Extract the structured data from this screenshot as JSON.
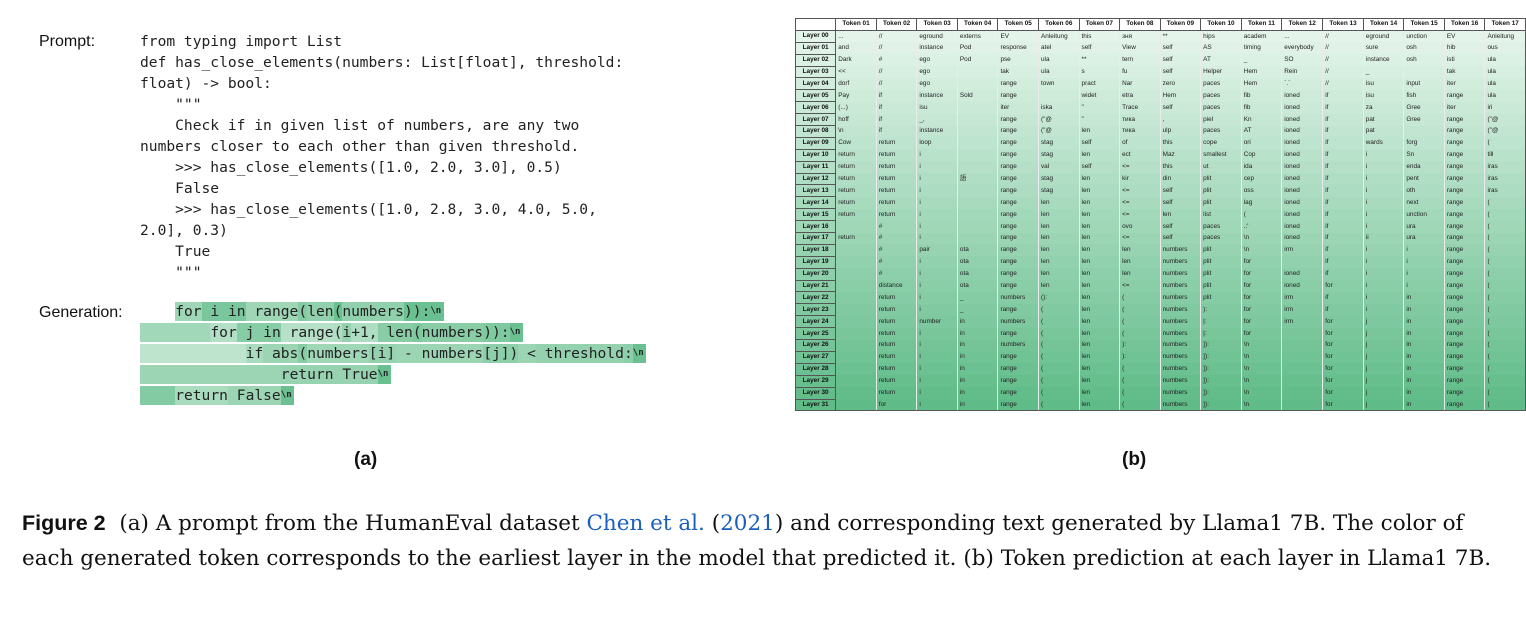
{
  "panel_a": {
    "prompt_label": "Prompt:",
    "generation_label": "Generation:",
    "prompt_lines": [
      "from typing import List",
      "def has_close_elements(numbers: List[float], threshold:",
      "float) -> bool:",
      "    \"\"\"",
      "    Check if in given list of numbers, are any two",
      "numbers closer to each other than given threshold.",
      "    >>> has_close_elements([1.0, 2.0, 3.0], 0.5)",
      "    False",
      "    >>> has_close_elements([1.0, 2.8, 3.0, 4.0, 5.0,",
      "2.0], 0.3)",
      "    True",
      "    \"\"\""
    ],
    "generation_lines": [
      [
        {
          "t": "    ",
          "s": 0
        },
        {
          "t": "for",
          "s": 0.53
        },
        {
          "t": " i",
          "s": 0.78
        },
        {
          "t": " in",
          "s": 0.78
        },
        {
          "t": " range",
          "s": 0.53
        },
        {
          "t": "(",
          "s": 0.72
        },
        {
          "t": "len",
          "s": 0.63
        },
        {
          "t": "(",
          "s": 0.9
        },
        {
          "t": "numbers",
          "s": 0.63
        },
        {
          "t": ")):",
          "s": 0.9
        },
        {
          "t": "\\n",
          "s": 0.9,
          "nl": true
        }
      ],
      [
        {
          "t": "        ",
          "s": 0.5
        },
        {
          "t": "for",
          "s": 0.38
        },
        {
          "t": " j",
          "s": 0.7
        },
        {
          "t": " in",
          "s": 0.7
        },
        {
          "t": " range",
          "s": 0.36
        },
        {
          "t": "(",
          "s": 0.4
        },
        {
          "t": "i",
          "s": 0.6
        },
        {
          "t": "+1,",
          "s": 0.42
        },
        {
          "t": " len",
          "s": 0.68
        },
        {
          "t": "(",
          "s": 0.75
        },
        {
          "t": "numbers",
          "s": 0.68
        },
        {
          "t": ")):",
          "s": 0.75
        },
        {
          "t": "\\n",
          "s": 0.9,
          "nl": true
        }
      ],
      [
        {
          "t": "            ",
          "s": 0.3
        },
        {
          "t": "if",
          "s": 0.45
        },
        {
          "t": " abs",
          "s": 0.55
        },
        {
          "t": "(",
          "s": 0.7
        },
        {
          "t": "numbers",
          "s": 0.52
        },
        {
          "t": "[i]",
          "s": 0.6
        },
        {
          "t": " -",
          "s": 0.55
        },
        {
          "t": " numbers",
          "s": 0.55
        },
        {
          "t": "[j])",
          "s": 0.65
        },
        {
          "t": " <",
          "s": 0.55
        },
        {
          "t": " threshold",
          "s": 0.6
        },
        {
          "t": ":",
          "s": 0.65
        },
        {
          "t": "\\n",
          "s": 0.9,
          "nl": true
        }
      ],
      [
        {
          "t": "                ",
          "s": 0.55
        },
        {
          "t": "return",
          "s": 0.58
        },
        {
          "t": " True",
          "s": 0.58
        },
        {
          "t": "\\n",
          "s": 0.9,
          "nl": true
        }
      ],
      [
        {
          "t": "    ",
          "s": 0.72
        },
        {
          "t": "return",
          "s": 0.45
        },
        {
          "t": " False",
          "s": 0.55
        },
        {
          "t": "\\n",
          "s": 0.9,
          "nl": true
        }
      ]
    ]
  },
  "panel_labels": {
    "a": "(a)",
    "b": "(b)"
  },
  "layer_table": {
    "headers": [
      "",
      "Token 01",
      "Token 02",
      "Token 03",
      "Token 04",
      "Token 05",
      "Token 06",
      "Token 07",
      "Token 08",
      "Token 09",
      "Token 10",
      "Token 11",
      "Token 12",
      "Token 13",
      "Token 14",
      "Token 15",
      "Token 16",
      "Token 17"
    ],
    "rows": [
      {
        "layer": "Layer 00",
        "cells": [
          "...",
          "//",
          "eground",
          "externs",
          "EV",
          "Anleitung",
          "this",
          "зня",
          "**",
          "hips",
          "academ",
          "...",
          "//",
          "eground",
          "unction",
          "EV",
          "Anleitung"
        ]
      },
      {
        "layer": "Layer 01",
        "cells": [
          "and",
          "//",
          "instance",
          "Pod",
          "response",
          "atel",
          "self",
          "View",
          "self",
          "AS",
          "timing",
          "everybody",
          "//",
          "sure",
          "osh",
          "hib",
          "ous"
        ]
      },
      {
        "layer": "Layer 02",
        "cells": [
          "Dark",
          "#",
          "ego",
          "Pod",
          "pse",
          "ula",
          "**",
          "tern",
          "self",
          "AT",
          "_",
          "SO",
          "//",
          "instance",
          "osh",
          "isti",
          "ula"
        ]
      },
      {
        "layer": "Layer 03",
        "cells": [
          "<<",
          "//",
          "ego",
          "",
          "tak",
          "ula",
          "s",
          "fu",
          "self",
          "Helper",
          "Hem",
          "Rein",
          "//",
          "_",
          "",
          "tak",
          "ula"
        ]
      },
      {
        "layer": "Layer 04",
        "cells": [
          "dorf",
          "//",
          "ego",
          "",
          "range",
          "town",
          "pract",
          "Nar",
          "zero",
          "paces",
          "Hem",
          "`.`",
          "//",
          "isu",
          "input",
          "iter",
          "ula"
        ]
      },
      {
        "layer": "Layer 05",
        "cells": [
          "Pay",
          "if",
          "instance",
          "Sold",
          "range",
          "",
          "widet",
          "etra",
          "Hem",
          "paces",
          "fib",
          "ioned",
          "if",
          "isu",
          "fish",
          "range",
          "ula"
        ]
      },
      {
        "layer": "Layer 06",
        "cells": [
          "(...)",
          "if",
          "isu",
          "",
          "iter",
          "iska",
          "\"",
          "Trace",
          "self",
          "paces",
          "fib",
          "ioned",
          "if",
          "za",
          "Gree",
          "iter",
          "iri"
        ]
      },
      {
        "layer": "Layer 07",
        "cells": [
          "hoff",
          "if",
          "_,",
          "",
          "range",
          "(\"@",
          "\"",
          "тика",
          ",",
          "piel",
          "Kn",
          "ioned",
          "if",
          "pat",
          "Gree",
          "range",
          "(\"@"
        ]
      },
      {
        "layer": "Layer 08",
        "cells": [
          "\\n",
          "if",
          "instance",
          "",
          "range",
          "(\"@",
          "len",
          "тика",
          "ulp",
          "paces",
          "AT",
          "ioned",
          "if",
          "pat",
          "",
          "range",
          "(\"@"
        ]
      },
      {
        "layer": "Layer 09",
        "cells": [
          "Cow",
          "return",
          "loop",
          "",
          "range",
          "stag",
          "self",
          "of",
          "this",
          "cope",
          "ori",
          "ioned",
          "if",
          "wards",
          "forg",
          "range",
          "("
        ]
      },
      {
        "layer": "Layer 10",
        "cells": [
          "return",
          "return",
          "i",
          "",
          "range",
          "stag",
          "len",
          "ect",
          "Maz",
          "smallest",
          "Cop",
          "ioned",
          "if",
          "i",
          "Sn",
          "range",
          "till"
        ]
      },
      {
        "layer": "Layer 11",
        "cells": [
          "return",
          "return",
          "i",
          "",
          "range",
          "val",
          "self",
          "<=",
          "this",
          "ut",
          "ida",
          "ioned",
          "if",
          "i",
          "enda",
          "range",
          "iras"
        ]
      },
      {
        "layer": "Layer 12",
        "cells": [
          "return",
          "return",
          "i",
          "語",
          "range",
          "stag",
          "len",
          "kir",
          "din",
          "plit",
          "cep",
          "ioned",
          "if",
          "i",
          "pent",
          "range",
          "iras"
        ]
      },
      {
        "layer": "Layer 13",
        "cells": [
          "return",
          "return",
          "i",
          "",
          "range",
          "stag",
          "len",
          "<=",
          "self",
          "plit",
          "oss",
          "ioned",
          "if",
          "i",
          "oth",
          "range",
          "iras"
        ]
      },
      {
        "layer": "Layer 14",
        "cells": [
          "return",
          "return",
          "i",
          "",
          "range",
          "len",
          "len",
          "<=",
          "self",
          "plit",
          "lag",
          "ioned",
          "if",
          "i",
          "next",
          "range",
          "("
        ]
      },
      {
        "layer": "Layer 15",
        "cells": [
          "return",
          "return",
          "i",
          "",
          "range",
          "len",
          "len",
          "<=",
          "len",
          "list",
          "(",
          "ioned",
          "if",
          "i",
          "unction",
          "range",
          "("
        ]
      },
      {
        "layer": "Layer 16",
        "cells": [
          "",
          "#",
          "i",
          "",
          "range",
          "len",
          "len",
          "ovo",
          "self",
          "paces",
          ".:'",
          "ioned",
          "if",
          "i",
          "ura",
          "range",
          "("
        ]
      },
      {
        "layer": "Layer 17",
        "cells": [
          "return",
          "#",
          "i",
          "",
          "range",
          "len",
          "len",
          "<=",
          "self",
          "paces",
          "\\n",
          "ioned",
          "if",
          "ii",
          "ura",
          "range",
          "("
        ]
      },
      {
        "layer": "Layer 18",
        "cells": [
          "",
          "#",
          "pair",
          "ota",
          "range",
          "len",
          "len",
          "len",
          "numbers",
          "plit",
          "\\n",
          "irm",
          "if",
          "i",
          "i",
          "range",
          "("
        ]
      },
      {
        "layer": "Layer 19",
        "cells": [
          "",
          "#",
          "i",
          "ota",
          "range",
          "len",
          "len",
          "len",
          "numbers",
          "plit",
          "for",
          "",
          "if",
          "i",
          "i",
          "range",
          "("
        ]
      },
      {
        "layer": "Layer 20",
        "cells": [
          "",
          "#",
          "i",
          "ota",
          "range",
          "len",
          "len",
          "len",
          "numbers",
          "plit",
          "for",
          "ioned",
          "if",
          "i",
          "i",
          "range",
          "("
        ]
      },
      {
        "layer": "Layer 21",
        "cells": [
          "",
          "distance",
          "i",
          "ota",
          "range",
          "len",
          "len",
          "<=",
          "numbers",
          "plit",
          "for",
          "ioned",
          "for",
          "i",
          "i",
          "range",
          "("
        ]
      },
      {
        "layer": "Layer 22",
        "cells": [
          "",
          "return",
          "i",
          "_",
          "numbers",
          "():",
          "len",
          "(",
          "numbers",
          "plit",
          "for",
          "irm",
          "if",
          "i",
          "in",
          "range",
          "("
        ]
      },
      {
        "layer": "Layer 23",
        "cells": [
          "",
          "return",
          "i",
          "_",
          "range",
          "(",
          "len",
          "(",
          "numbers",
          "):",
          "for",
          "irm",
          "if",
          "i",
          "in",
          "range",
          "("
        ]
      },
      {
        "layer": "Layer 24",
        "cells": [
          "",
          "return",
          "number",
          "in",
          "numbers",
          "(",
          "len",
          "(",
          "numbers",
          "|:",
          "for",
          "irm",
          "for",
          "j",
          "in",
          "range",
          "("
        ]
      },
      {
        "layer": "Layer 25",
        "cells": [
          "",
          "return",
          "i",
          "in",
          "range",
          "(",
          "len",
          "(",
          "numbers",
          "|:",
          "for",
          "",
          "for",
          "j",
          "in",
          "range",
          "("
        ]
      },
      {
        "layer": "Layer 26",
        "cells": [
          "",
          "return",
          "i",
          "in",
          "numbers",
          "(",
          "len",
          "):",
          "numbers",
          "]):",
          "\\n",
          "",
          "for",
          "j",
          "in",
          "range",
          "("
        ]
      },
      {
        "layer": "Layer 27",
        "cells": [
          "",
          "return",
          "i",
          "in",
          "range",
          "(",
          "len",
          "):",
          "numbers",
          "]):",
          "\\n",
          "",
          "for",
          "j",
          "in",
          "range",
          "("
        ]
      },
      {
        "layer": "Layer 28",
        "cells": [
          "",
          "return",
          "i",
          "in",
          "range",
          "(",
          "len",
          "(",
          "numbers",
          "]):",
          "\\n",
          "",
          "for",
          "j",
          "in",
          "range",
          "("
        ]
      },
      {
        "layer": "Layer 29",
        "cells": [
          "",
          "return",
          "i",
          "in",
          "range",
          "(",
          "len",
          "(",
          "numbers",
          "]):",
          "\\n",
          "",
          "for",
          "j",
          "in",
          "range",
          "("
        ]
      },
      {
        "layer": "Layer 30",
        "cells": [
          "",
          "return",
          "i",
          "in",
          "range",
          "(",
          "len",
          "(",
          "numbers",
          "]):",
          "\\n",
          "",
          "for",
          "j",
          "in",
          "range",
          "("
        ]
      },
      {
        "layer": "Layer 31",
        "cells": [
          "",
          "for",
          "i",
          "in",
          "range",
          "(",
          "len",
          "(",
          "numbers",
          "]):",
          "\\n",
          "",
          "for",
          "j",
          "in",
          "range",
          "("
        ]
      }
    ]
  },
  "caption": {
    "figure_label": "Figure 2",
    "part1": "(a) A prompt from the HumanEval dataset ",
    "citation_author": "Chen et al.",
    "citation_open": " (",
    "citation_year": "2021",
    "part2": ") and corresponding text generated by Llama1 7B. The color of each generated token corresponds to the earliest layer in the model that predicted it. (b) Token prediction at each layer in Llama1 7B."
  }
}
